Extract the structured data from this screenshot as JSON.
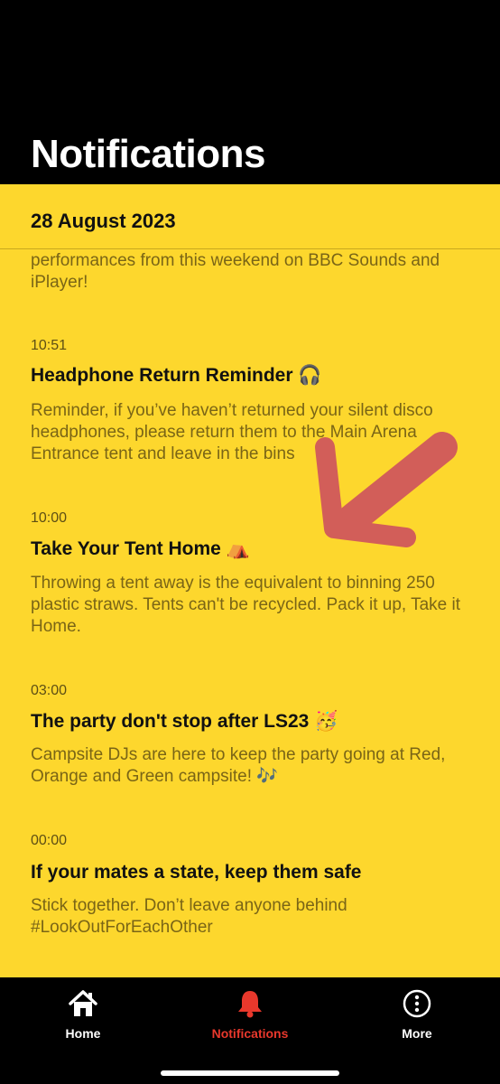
{
  "header": {
    "title": "Notifications"
  },
  "section": {
    "date": "28 August 2023"
  },
  "notifications": {
    "partial_body": "performances from this weekend on BBC Sounds and iPlayer!",
    "items": [
      {
        "time": "10:51",
        "title": "Headphone Return Reminder 🎧",
        "body": "Reminder, if you’ve haven’t returned your silent disco headphones, please return them to the Main Arena Entrance tent and leave in the bins"
      },
      {
        "time": "10:00",
        "title": "Take Your Tent Home ⛺",
        "body": "Throwing a tent away is the equivalent to binning 250 plastic straws. Tents can't be recycled. Pack it up, Take it Home."
      },
      {
        "time": "03:00",
        "title": "The party don't stop after LS23 🥳",
        "body": "Campsite DJs are here to keep the party going at Red, Orange and Green campsite! 🎶"
      },
      {
        "time": "00:00",
        "title": "If your mates a state, keep them safe",
        "body": "Stick together. Don’t leave anyone behind #LookOutForEachOther"
      }
    ]
  },
  "tabs": [
    {
      "label": "Home",
      "icon": "home-icon",
      "active": false
    },
    {
      "label": "Notifications",
      "icon": "bell-icon",
      "active": true
    },
    {
      "label": "More",
      "icon": "more-icon",
      "active": false
    }
  ],
  "colors": {
    "accent": "#fdd72d",
    "active_tab": "#e8382c",
    "inactive_tab": "#ffffff",
    "annotation": "#c2306a"
  }
}
